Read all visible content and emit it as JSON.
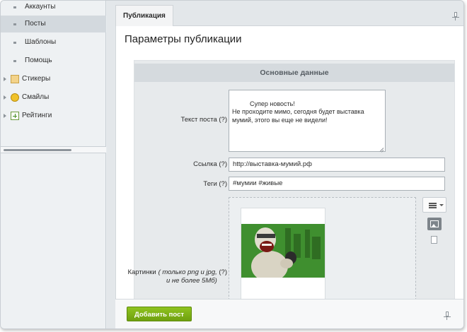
{
  "sidebar": {
    "items": [
      {
        "label": "Аккаунты"
      },
      {
        "label": "Посты"
      },
      {
        "label": "Шаблоны"
      },
      {
        "label": "Помощь"
      },
      {
        "label": "Стикеры"
      },
      {
        "label": "Смайлы"
      },
      {
        "label": "Рейтинги"
      }
    ]
  },
  "tabs": [
    {
      "label": "Публикация"
    }
  ],
  "page": {
    "title": "Параметры публикации"
  },
  "form": {
    "section_title": "Основные данные",
    "post_text_label": "Текст поста (?)",
    "post_text_value": "Супер новость!\nНе проходите мимо, сегодня будет выставка мумий, этого вы еще не видели!",
    "link_label": "Ссылка (?)",
    "link_value": "http://выставка-мумий.рф",
    "tags_label": "Теги (?)",
    "tags_value": "#мумии #живые",
    "images_label_prefix": "Картинки",
    "images_label_note": "( только png и jpg, и не более 5Мб)",
    "images_label_suffix": " (?)"
  },
  "footer": {
    "submit_label": "Добавить пост"
  },
  "icons": {
    "stickers": "sticker-icon",
    "smiles": "smile-icon",
    "ratings": "rating-icon",
    "pin": "pin-icon",
    "menu": "menu-icon",
    "image": "image-icon",
    "file": "file-icon"
  },
  "colors": {
    "accent_green": "#7ab317",
    "sidebar_active": "#d3d9de",
    "section_header": "#d5dade"
  }
}
